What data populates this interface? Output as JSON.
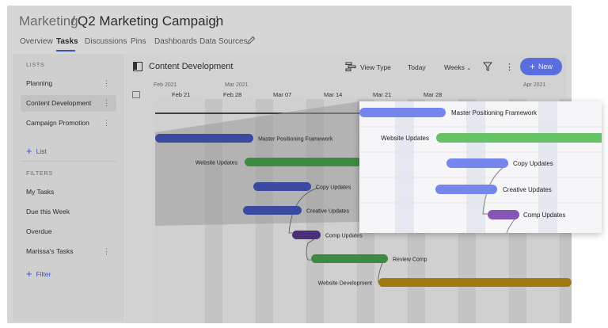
{
  "breadcrumb": {
    "workspace": "Marketing",
    "separator": "/",
    "project": "Q2 Marketing Campaign",
    "menu_icon": "kebab-icon"
  },
  "tabs": [
    {
      "label": "Overview"
    },
    {
      "label": "Tasks",
      "active": true
    },
    {
      "label": "Discussions"
    },
    {
      "label": "Pins"
    },
    {
      "label": "Dashboards"
    },
    {
      "label": "Data Sources"
    }
  ],
  "sidebar": {
    "lists_heading": "LISTS",
    "lists": [
      {
        "label": "Planning"
      },
      {
        "label": "Content Development",
        "active": true
      },
      {
        "label": "Campaign Promotion"
      }
    ],
    "add_list": "List",
    "filters_heading": "FILTERS",
    "filters": [
      {
        "label": "My Tasks"
      },
      {
        "label": "Due this Week"
      },
      {
        "label": "Overdue"
      },
      {
        "label": "Marissa's Tasks"
      }
    ],
    "add_filter": "Filter"
  },
  "panel": {
    "title": "Content Development",
    "view_type": "View Type",
    "today": "Today",
    "weeks": "Weeks",
    "new": "New"
  },
  "timeline": {
    "months": [
      "Feb 2021",
      "Mar 2021",
      "Apr 2021"
    ],
    "weeks": [
      "Feb 21",
      "Feb 28",
      "Mar 07",
      "Mar 14",
      "Mar 21",
      "Mar 28"
    ]
  },
  "tasks": [
    {
      "name": "Master Positioning Framework",
      "color": "#3a4aa0"
    },
    {
      "name": "Website Updates",
      "color": "#3f8a43"
    },
    {
      "name": "Copy Updates",
      "color": "#3a4aa0"
    },
    {
      "name": "Creative Updates",
      "color": "#3a4aa0"
    },
    {
      "name": "Comp Updates",
      "color": "#4a2f7a"
    },
    {
      "name": "Review Comp",
      "color": "#3f8a43"
    },
    {
      "name": "Website Development",
      "color": "#a07a10"
    }
  ],
  "zoom_tasks": [
    {
      "name": "Master Positioning Framework",
      "color": "#7586ec"
    },
    {
      "name": "Website Updates",
      "color": "#66c266"
    },
    {
      "name": "Copy Updates",
      "color": "#7586ec"
    },
    {
      "name": "Creative Updates",
      "color": "#7586ec"
    },
    {
      "name": "Comp Updates",
      "color": "#8656b6"
    }
  ]
}
